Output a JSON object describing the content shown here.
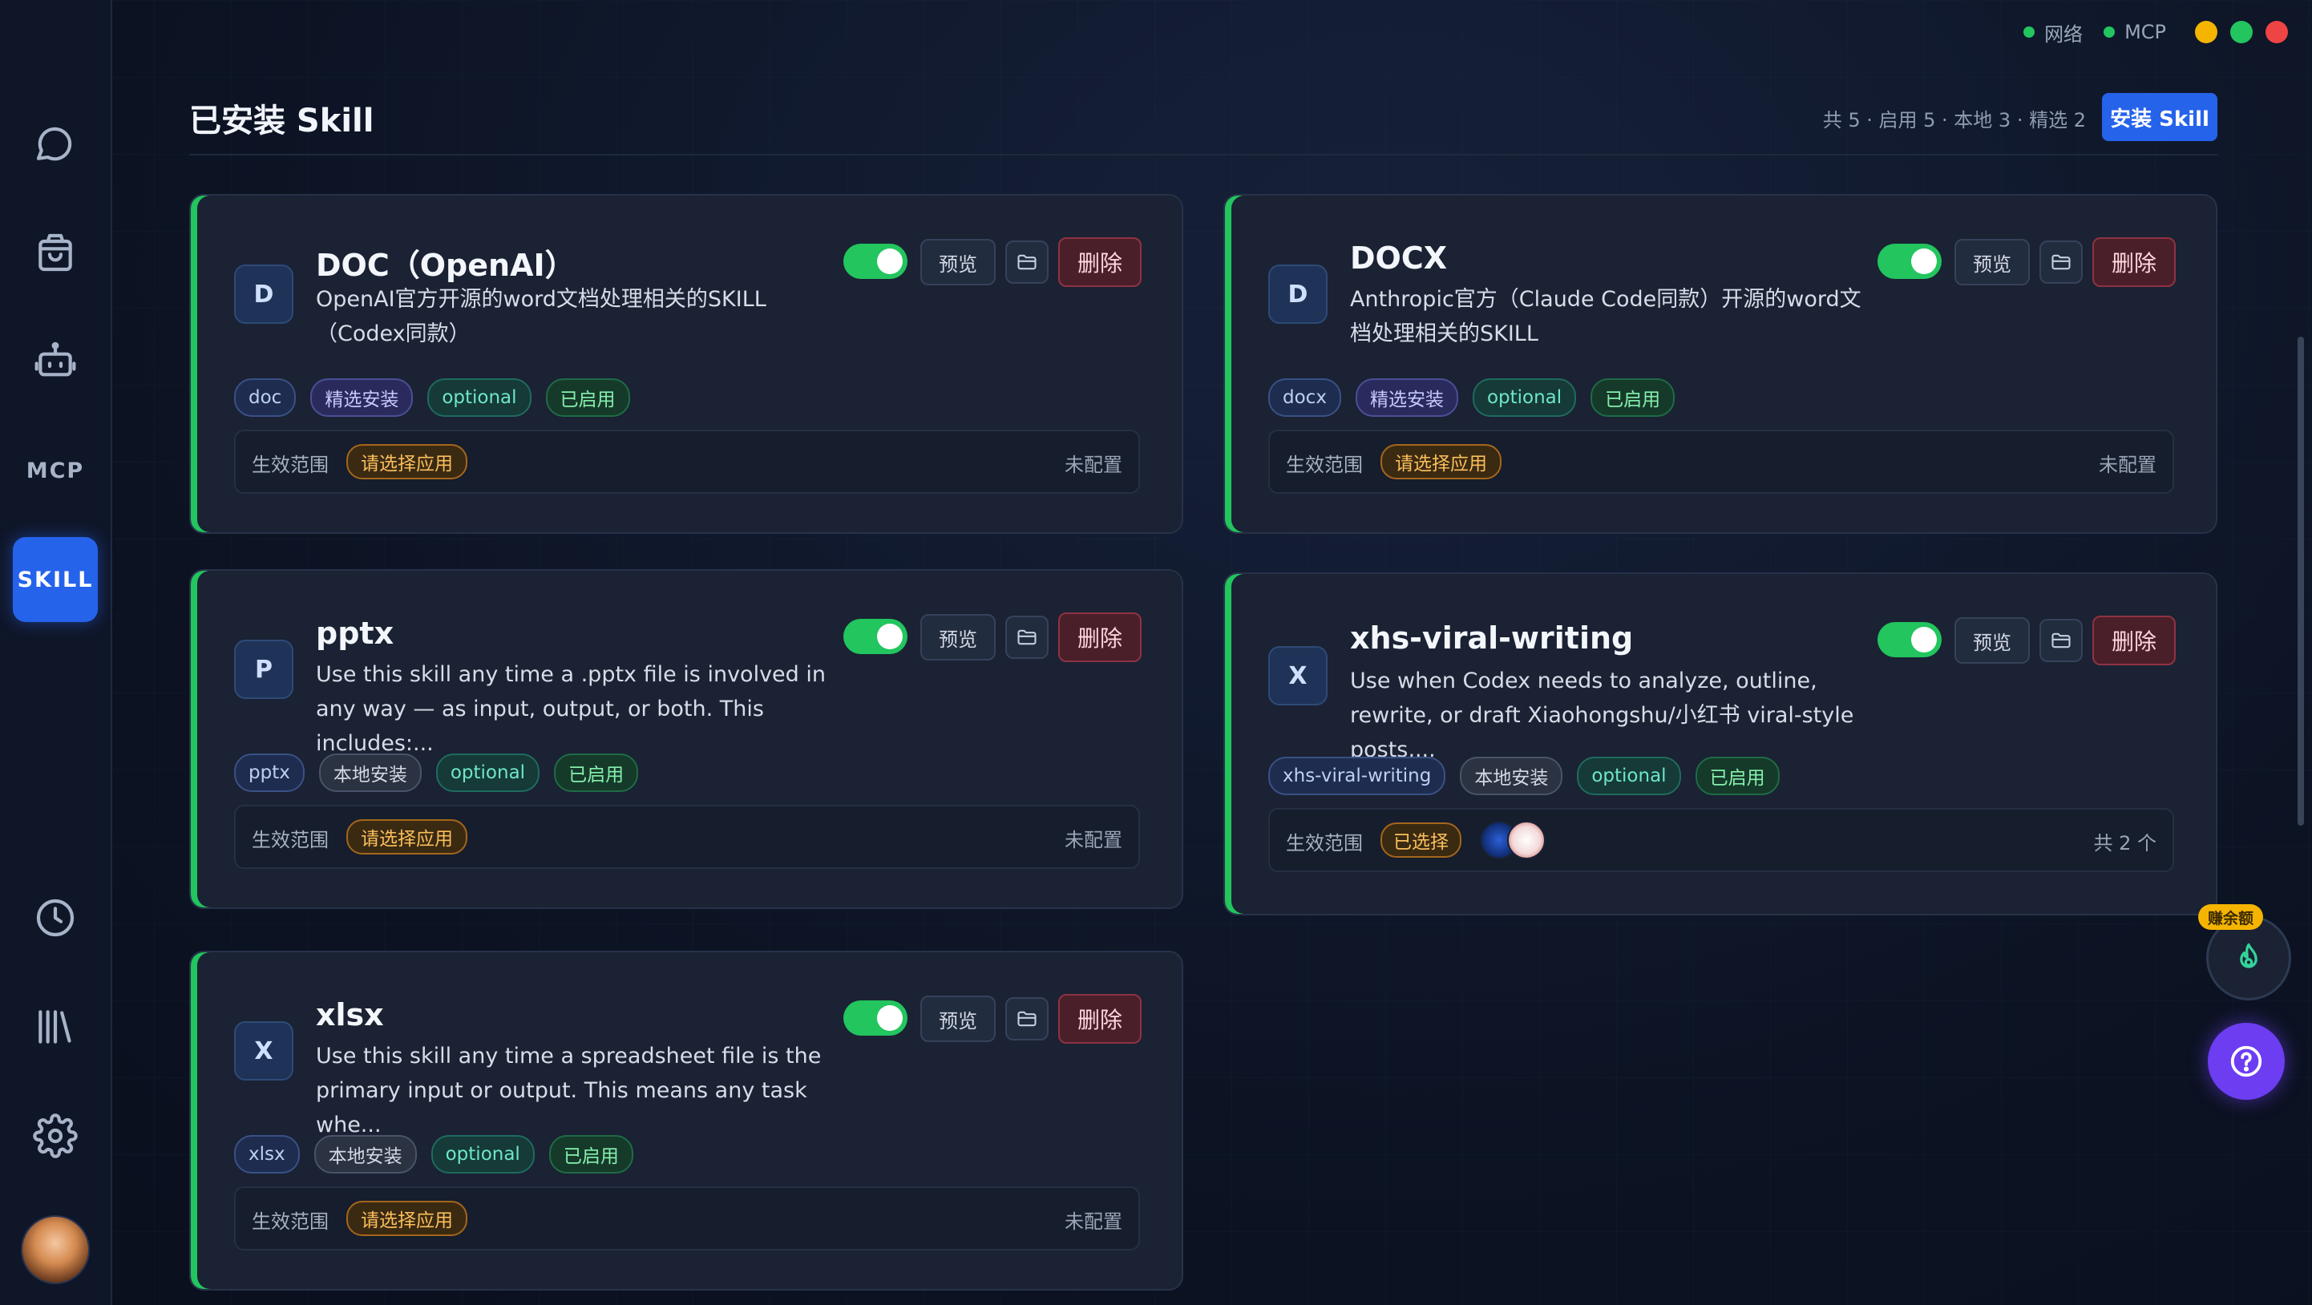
{
  "status": {
    "network_label": "网络",
    "mcp_label": "MCP",
    "traffic_colors": [
      "#f5b400",
      "#22c55e",
      "#ef4444"
    ]
  },
  "sidebar": {
    "items": [
      {
        "name": "chat",
        "icon": "chat-bubble-icon"
      },
      {
        "name": "store",
        "icon": "shopping-bag-icon"
      },
      {
        "name": "agent",
        "icon": "robot-icon"
      },
      {
        "name": "mcp",
        "label": "MCP"
      },
      {
        "name": "skill",
        "label": "SKILL",
        "active": true
      },
      {
        "name": "history",
        "icon": "clock-icon"
      },
      {
        "name": "library",
        "icon": "library-icon"
      },
      {
        "name": "settings",
        "icon": "gear-icon"
      }
    ]
  },
  "header": {
    "title": "已安装 Skill",
    "summary": "共 5 · 启用 5 · 本地 3 · 精选 2",
    "install_label": "安装 Skill"
  },
  "common": {
    "preview_label": "预览",
    "delete_label": "删除",
    "scope_label": "生效范围"
  },
  "cards": [
    {
      "icon_letter": "D",
      "title": "DOC（OpenAI）",
      "description": "OpenAI官方开源的word文档处理相关的SKILL（Codex同款）",
      "enabled": true,
      "tags": [
        {
          "text": "doc",
          "kind": "name"
        },
        {
          "text": "精选安装",
          "kind": "featured"
        },
        {
          "text": "optional",
          "kind": "optional"
        },
        {
          "text": "已启用",
          "kind": "enabled"
        }
      ],
      "scope_chip": "请选择应用",
      "scope_right": "未配置"
    },
    {
      "icon_letter": "D",
      "title": "DOCX",
      "description": "Anthropic官方（Claude Code同款）开源的word文档处理相关的SKILL",
      "enabled": true,
      "tags": [
        {
          "text": "docx",
          "kind": "name"
        },
        {
          "text": "精选安装",
          "kind": "featured"
        },
        {
          "text": "optional",
          "kind": "optional"
        },
        {
          "text": "已启用",
          "kind": "enabled"
        }
      ],
      "scope_chip": "请选择应用",
      "scope_right": "未配置"
    },
    {
      "icon_letter": "P",
      "title": "pptx",
      "description": "Use this skill any time a .pptx file is involved in any way — as input, output, or both. This includes:...",
      "enabled": true,
      "tags": [
        {
          "text": "pptx",
          "kind": "name"
        },
        {
          "text": "本地安装",
          "kind": "local"
        },
        {
          "text": "optional",
          "kind": "optional"
        },
        {
          "text": "已启用",
          "kind": "enabled"
        }
      ],
      "scope_chip": "请选择应用",
      "scope_right": "未配置"
    },
    {
      "icon_letter": "X",
      "title": "xhs-viral-writing",
      "description": "Use when Codex needs to analyze, outline, rewrite, or draft Xiaohongshu/小红书 viral-style posts,...",
      "enabled": true,
      "tags": [
        {
          "text": "xhs-viral-writing",
          "kind": "name"
        },
        {
          "text": "本地安装",
          "kind": "local"
        },
        {
          "text": "optional",
          "kind": "optional"
        },
        {
          "text": "已启用",
          "kind": "enabled"
        }
      ],
      "scope_chip": "已选择",
      "scope_right": "共 2 个"
    },
    {
      "icon_letter": "X",
      "title": "xlsx",
      "description": "Use this skill any time a spreadsheet file is the primary input or output. This means any task whe...",
      "enabled": true,
      "tags": [
        {
          "text": "xlsx",
          "kind": "name"
        },
        {
          "text": "本地安装",
          "kind": "local"
        },
        {
          "text": "optional",
          "kind": "optional"
        },
        {
          "text": "已启用",
          "kind": "enabled"
        }
      ],
      "scope_chip": "请选择应用",
      "scope_right": "未配置"
    }
  ],
  "floating": {
    "earn_badge": "赚余额"
  }
}
